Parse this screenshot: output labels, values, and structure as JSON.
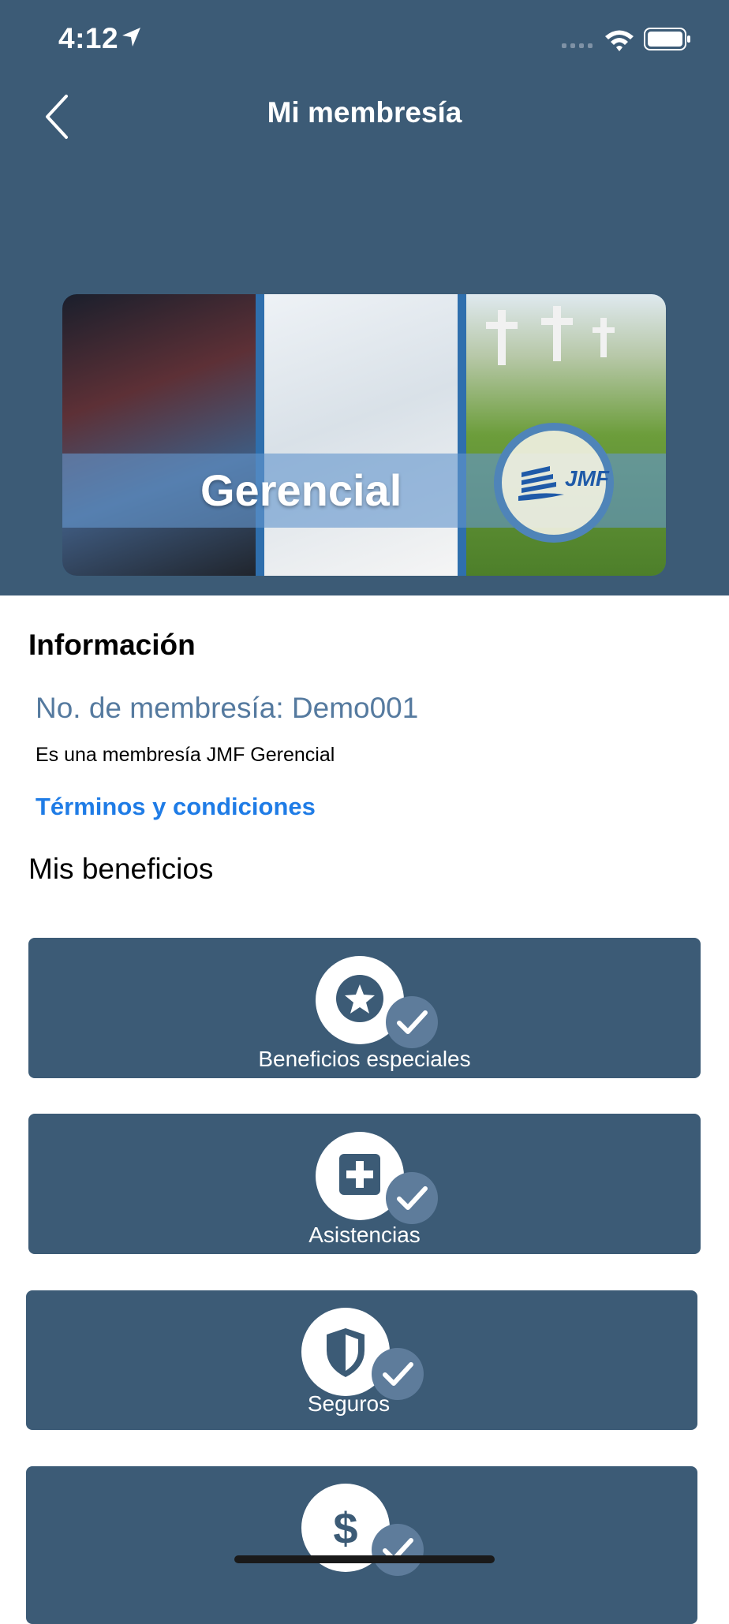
{
  "status_bar": {
    "time": "4:12",
    "icons": [
      "location-arrow-icon",
      "signal-icon",
      "wifi-icon",
      "battery-icon"
    ]
  },
  "nav": {
    "title": "Mi membresía",
    "back_icon": "chevron-left-icon"
  },
  "banner": {
    "label": "Gerencial",
    "logo_text": "JMF"
  },
  "info": {
    "heading": "Información",
    "membership_number": "No. de membresía: Demo001",
    "description": "Es una membresía JMF Gerencial",
    "terms_link": "Términos y condiciones"
  },
  "benefits": {
    "heading": "Mis beneficios",
    "items": [
      {
        "label": "Beneficios especiales",
        "icon": "star-badge-icon"
      },
      {
        "label": "Asistencias",
        "icon": "medical-cross-icon"
      },
      {
        "label": "Seguros",
        "icon": "shield-icon"
      },
      {
        "label": "",
        "icon": "dollar-icon"
      }
    ]
  },
  "colors": {
    "header_bg": "#3c5b76",
    "card_bg": "#3c5b76",
    "accent_link": "#1f7ce6",
    "membership_text": "#557a9f"
  }
}
